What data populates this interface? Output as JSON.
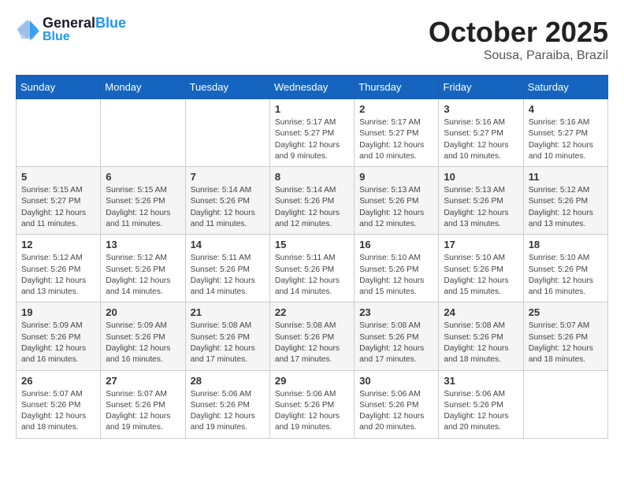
{
  "header": {
    "logo_line1": "General",
    "logo_line2": "Blue",
    "month": "October 2025",
    "location": "Sousa, Paraiba, Brazil"
  },
  "weekdays": [
    "Sunday",
    "Monday",
    "Tuesday",
    "Wednesday",
    "Thursday",
    "Friday",
    "Saturday"
  ],
  "weeks": [
    [
      {
        "day": "",
        "info": ""
      },
      {
        "day": "",
        "info": ""
      },
      {
        "day": "",
        "info": ""
      },
      {
        "day": "1",
        "info": "Sunrise: 5:17 AM\nSunset: 5:27 PM\nDaylight: 12 hours and 9 minutes."
      },
      {
        "day": "2",
        "info": "Sunrise: 5:17 AM\nSunset: 5:27 PM\nDaylight: 12 hours and 10 minutes."
      },
      {
        "day": "3",
        "info": "Sunrise: 5:16 AM\nSunset: 5:27 PM\nDaylight: 12 hours and 10 minutes."
      },
      {
        "day": "4",
        "info": "Sunrise: 5:16 AM\nSunset: 5:27 PM\nDaylight: 12 hours and 10 minutes."
      }
    ],
    [
      {
        "day": "5",
        "info": "Sunrise: 5:15 AM\nSunset: 5:27 PM\nDaylight: 12 hours and 11 minutes."
      },
      {
        "day": "6",
        "info": "Sunrise: 5:15 AM\nSunset: 5:26 PM\nDaylight: 12 hours and 11 minutes."
      },
      {
        "day": "7",
        "info": "Sunrise: 5:14 AM\nSunset: 5:26 PM\nDaylight: 12 hours and 11 minutes."
      },
      {
        "day": "8",
        "info": "Sunrise: 5:14 AM\nSunset: 5:26 PM\nDaylight: 12 hours and 12 minutes."
      },
      {
        "day": "9",
        "info": "Sunrise: 5:13 AM\nSunset: 5:26 PM\nDaylight: 12 hours and 12 minutes."
      },
      {
        "day": "10",
        "info": "Sunrise: 5:13 AM\nSunset: 5:26 PM\nDaylight: 12 hours and 13 minutes."
      },
      {
        "day": "11",
        "info": "Sunrise: 5:12 AM\nSunset: 5:26 PM\nDaylight: 12 hours and 13 minutes."
      }
    ],
    [
      {
        "day": "12",
        "info": "Sunrise: 5:12 AM\nSunset: 5:26 PM\nDaylight: 12 hours and 13 minutes."
      },
      {
        "day": "13",
        "info": "Sunrise: 5:12 AM\nSunset: 5:26 PM\nDaylight: 12 hours and 14 minutes."
      },
      {
        "day": "14",
        "info": "Sunrise: 5:11 AM\nSunset: 5:26 PM\nDaylight: 12 hours and 14 minutes."
      },
      {
        "day": "15",
        "info": "Sunrise: 5:11 AM\nSunset: 5:26 PM\nDaylight: 12 hours and 14 minutes."
      },
      {
        "day": "16",
        "info": "Sunrise: 5:10 AM\nSunset: 5:26 PM\nDaylight: 12 hours and 15 minutes."
      },
      {
        "day": "17",
        "info": "Sunrise: 5:10 AM\nSunset: 5:26 PM\nDaylight: 12 hours and 15 minutes."
      },
      {
        "day": "18",
        "info": "Sunrise: 5:10 AM\nSunset: 5:26 PM\nDaylight: 12 hours and 16 minutes."
      }
    ],
    [
      {
        "day": "19",
        "info": "Sunrise: 5:09 AM\nSunset: 5:26 PM\nDaylight: 12 hours and 16 minutes."
      },
      {
        "day": "20",
        "info": "Sunrise: 5:09 AM\nSunset: 5:26 PM\nDaylight: 12 hours and 16 minutes."
      },
      {
        "day": "21",
        "info": "Sunrise: 5:08 AM\nSunset: 5:26 PM\nDaylight: 12 hours and 17 minutes."
      },
      {
        "day": "22",
        "info": "Sunrise: 5:08 AM\nSunset: 5:26 PM\nDaylight: 12 hours and 17 minutes."
      },
      {
        "day": "23",
        "info": "Sunrise: 5:08 AM\nSunset: 5:26 PM\nDaylight: 12 hours and 17 minutes."
      },
      {
        "day": "24",
        "info": "Sunrise: 5:08 AM\nSunset: 5:26 PM\nDaylight: 12 hours and 18 minutes."
      },
      {
        "day": "25",
        "info": "Sunrise: 5:07 AM\nSunset: 5:26 PM\nDaylight: 12 hours and 18 minutes."
      }
    ],
    [
      {
        "day": "26",
        "info": "Sunrise: 5:07 AM\nSunset: 5:26 PM\nDaylight: 12 hours and 18 minutes."
      },
      {
        "day": "27",
        "info": "Sunrise: 5:07 AM\nSunset: 5:26 PM\nDaylight: 12 hours and 19 minutes."
      },
      {
        "day": "28",
        "info": "Sunrise: 5:06 AM\nSunset: 5:26 PM\nDaylight: 12 hours and 19 minutes."
      },
      {
        "day": "29",
        "info": "Sunrise: 5:06 AM\nSunset: 5:26 PM\nDaylight: 12 hours and 19 minutes."
      },
      {
        "day": "30",
        "info": "Sunrise: 5:06 AM\nSunset: 5:26 PM\nDaylight: 12 hours and 20 minutes."
      },
      {
        "day": "31",
        "info": "Sunrise: 5:06 AM\nSunset: 5:26 PM\nDaylight: 12 hours and 20 minutes."
      },
      {
        "day": "",
        "info": ""
      }
    ]
  ]
}
